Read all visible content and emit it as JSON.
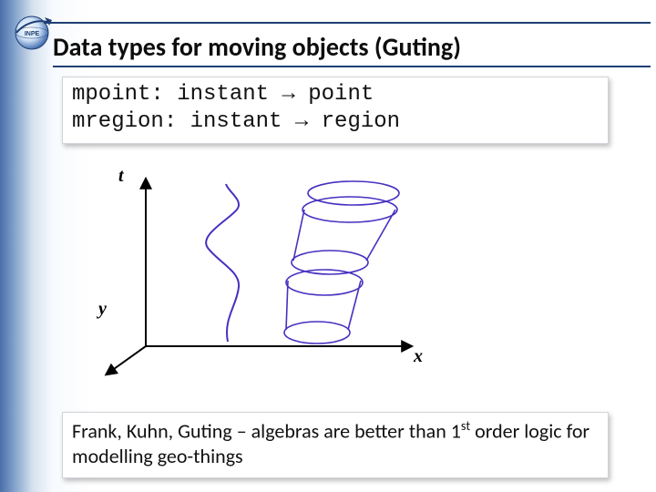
{
  "title": "Data types for moving objects (Guting)",
  "code": {
    "line1": "mpoint: instant → point",
    "line2": "mregion: instant → region"
  },
  "axes": {
    "t": "t",
    "y": "y",
    "x": "x"
  },
  "footer": {
    "prefix": "Frank, Kuhn, Guting – algebras are better than 1",
    "sup": "st",
    "suffix": " order logic for modelling geo-things"
  },
  "logo_alt": "INPE"
}
